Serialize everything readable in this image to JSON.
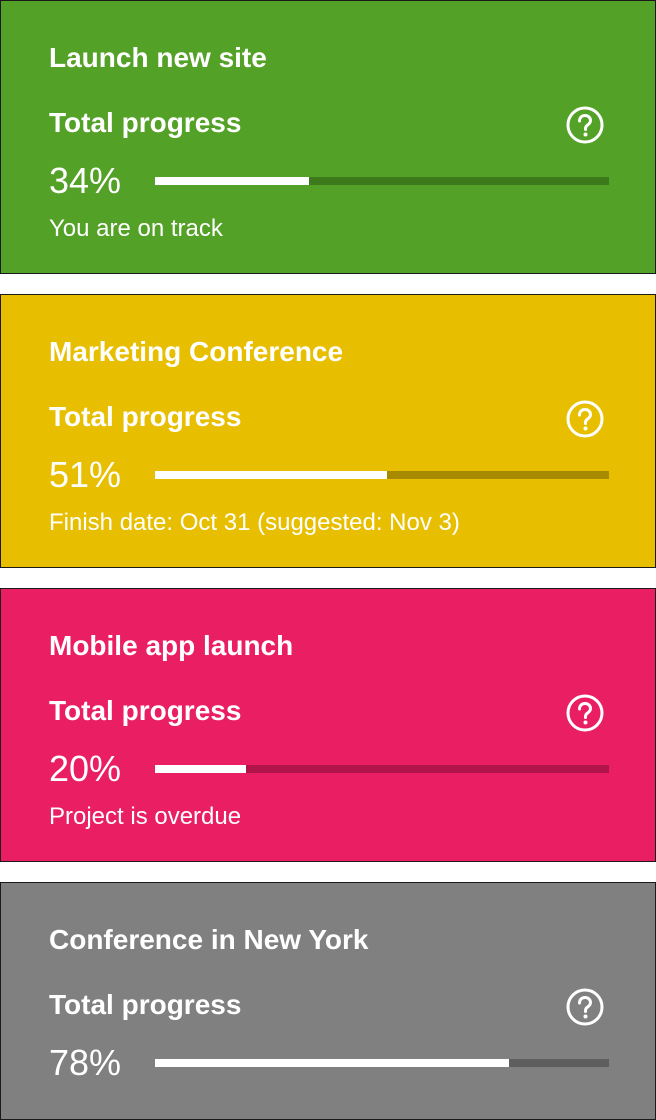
{
  "cards": [
    {
      "title": "Launch new site",
      "progress_label": "Total progress",
      "percent_text": "34%",
      "progress": 0.34,
      "status": "You are on track",
      "color": "#53a127",
      "track_color": "#3d7a1c"
    },
    {
      "title": "Marketing Conference",
      "progress_label": "Total progress",
      "percent_text": "51%",
      "progress": 0.51,
      "status": "Finish date: Oct 31 (suggested: Nov 3)",
      "color": "#e8bf00",
      "track_color": "#a88a00"
    },
    {
      "title": "Mobile app launch",
      "progress_label": "Total progress",
      "percent_text": "20%",
      "progress": 0.2,
      "status": "Project is overdue",
      "color": "#e91e63",
      "track_color": "#b0144a"
    },
    {
      "title": "Conference in New York",
      "progress_label": "Total progress",
      "percent_text": "78%",
      "progress": 0.78,
      "status": "",
      "color": "#808080",
      "track_color": "#5e5e5e"
    }
  ],
  "icons": {
    "help": "help-circle-icon"
  }
}
